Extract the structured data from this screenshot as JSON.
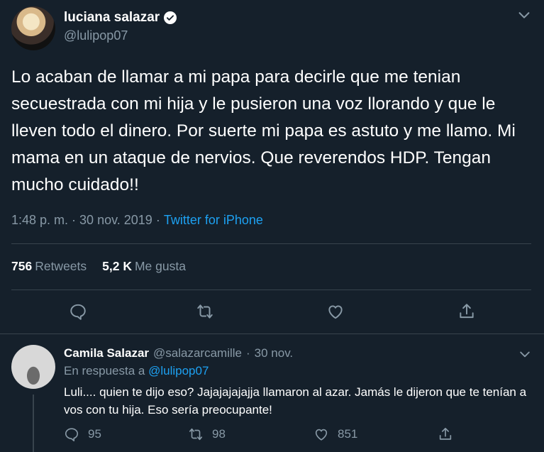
{
  "tweet": {
    "author_name": "luciana salazar",
    "handle": "@lulipop07",
    "text": "Lo acaban de llamar a mi papa para decirle que me tenian secuestrada con mi hija y le pusieron una voz llorando y que le lleven todo el dinero. Por suerte mi papa es astuto y me llamo. Mi mama en un ataque de nervios. Que reverendos HDP. Tengan mucho cuidado!!",
    "time": "1:48 p. m.",
    "date": "30 nov. 2019",
    "separator": " · ",
    "source": "Twitter for iPhone",
    "retweets_count": "756",
    "retweets_label": "Retweets",
    "likes_count": "5,2 K",
    "likes_label": "Me gusta",
    "icons": [
      "chevron-down-icon",
      "verified-icon",
      "reply-icon",
      "retweet-icon",
      "like-icon",
      "share-icon"
    ]
  },
  "reply": {
    "author_name": "Camila Salazar",
    "handle": "@salazarcamille",
    "separator": "·",
    "date": "30 nov.",
    "in_reply_prefix": "En respuesta a",
    "in_reply_handle": "@lulipop07",
    "text": "Luli.... quien te dijo eso? Jajajajajajja llamaron al azar. Jamás le dijeron que te tenían a vos con tu hija. Eso sería preocupante!",
    "reply_count": "95",
    "retweet_count": "98",
    "like_count": "851"
  },
  "colors": {
    "background": "#15202b",
    "text": "#ffffff",
    "secondary": "#8899a6",
    "accent": "#1da1f2",
    "divider": "#38444d"
  }
}
